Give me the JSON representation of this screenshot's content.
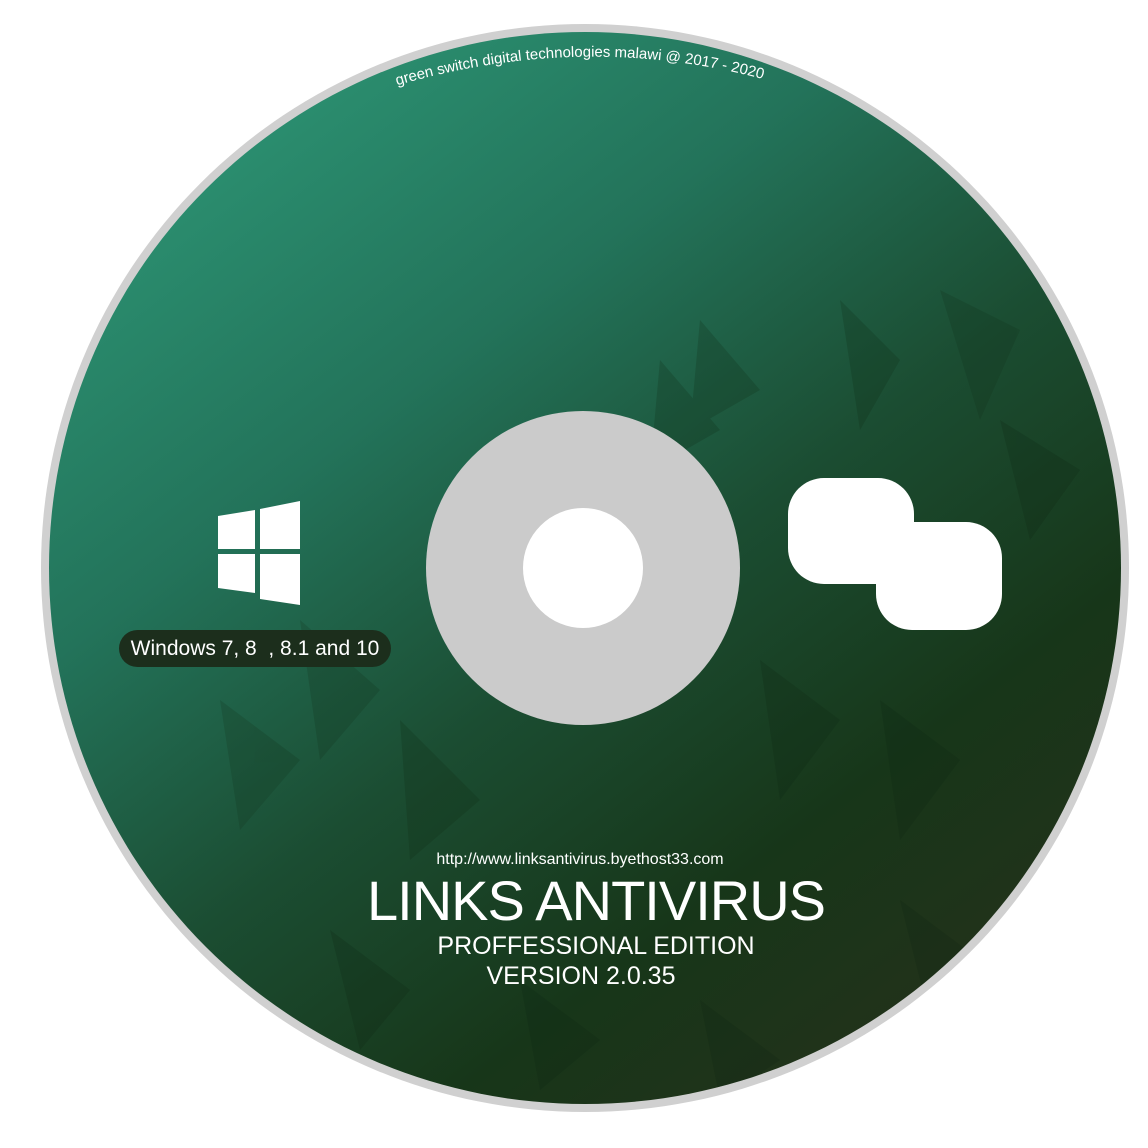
{
  "disc": {
    "copyright": "green switch digital technologies malawi @ 2017 - 2020",
    "os_support": "Windows 7, 8  , 8.1 and 10",
    "url": "http://www.linksantivirus.byethost33.com",
    "product_name": "LINKS ANTIVIRUS",
    "edition": "PROFFESSIONAL EDITION",
    "version": "VERSION 2.0.35"
  },
  "icons": {
    "windows": "windows-logo-icon",
    "brand": "links-antivirus-logo-icon"
  },
  "colors": {
    "disc_light": "#2a8c6e",
    "disc_mid": "#1e5a3e",
    "disc_dark": "#163019",
    "rim": "#cfcfcf",
    "hub": "#cbcbcb",
    "text": "#ffffff",
    "badge": "#1c2e1c"
  }
}
